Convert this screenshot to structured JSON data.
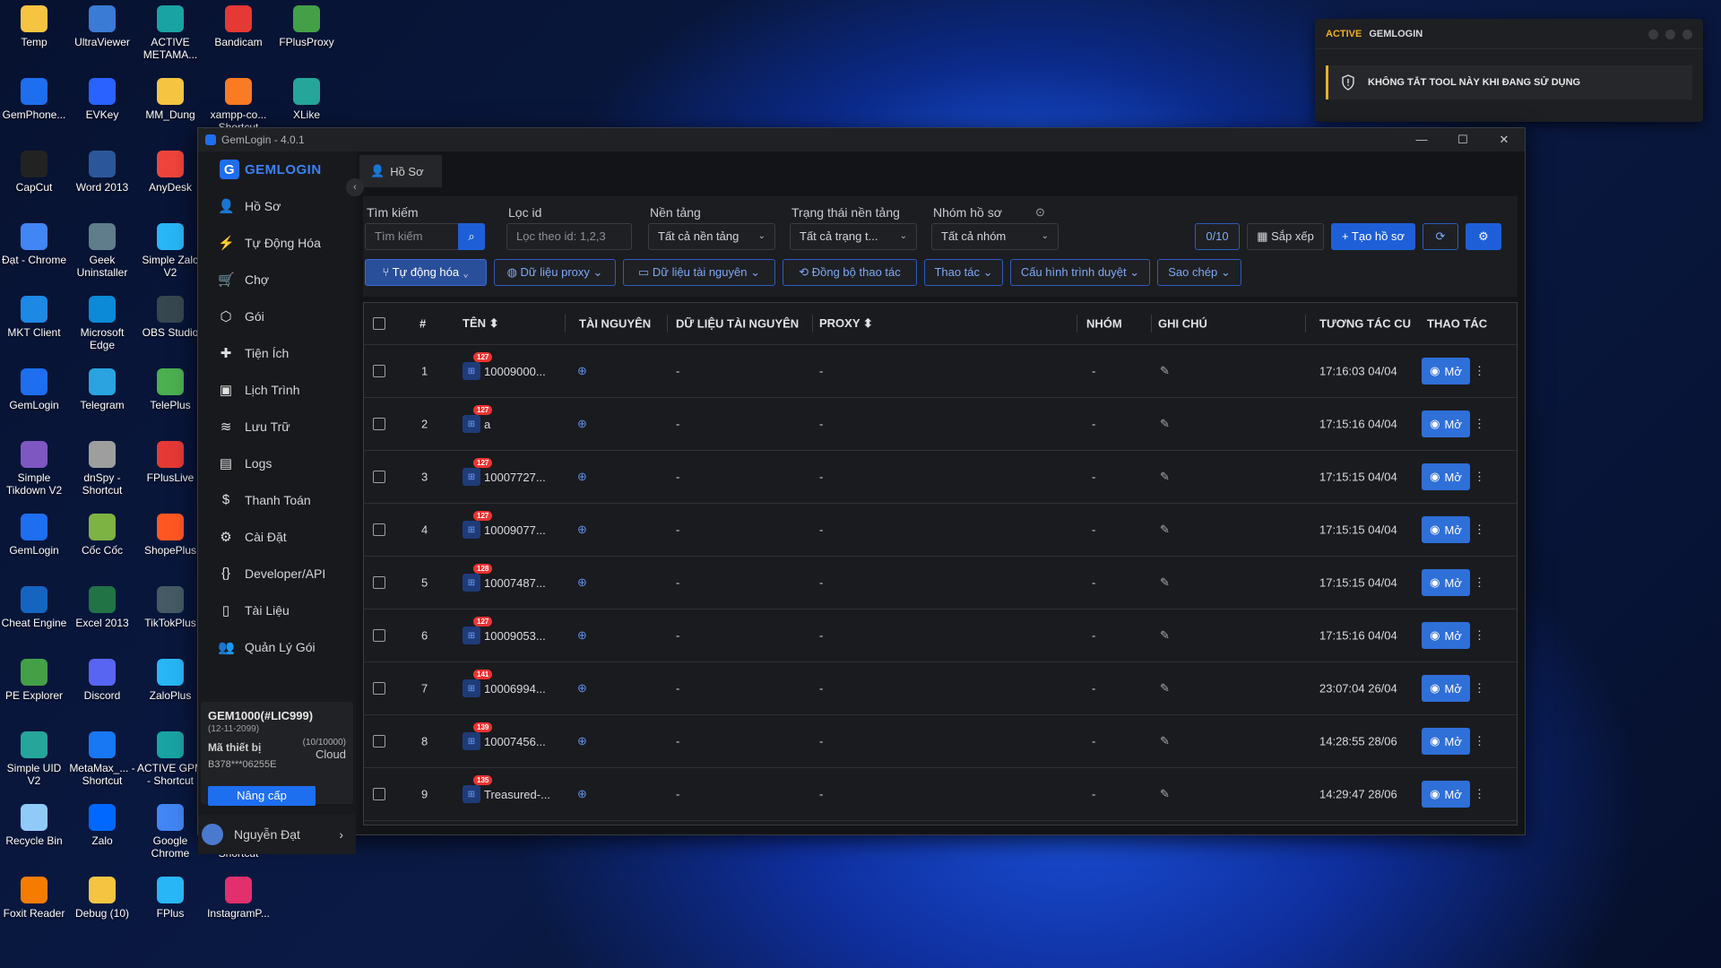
{
  "desktop_icons": [
    {
      "label": "Temp",
      "icon": "folder-icon",
      "color": "#f5c542"
    },
    {
      "label": "UltraViewer",
      "icon": "ultraviewer-icon",
      "color": "#3a7bd5"
    },
    {
      "label": "ACTIVE METAMA...",
      "icon": "edge-icon",
      "color": "#1aa3a3"
    },
    {
      "label": "Bandicam",
      "icon": "record-icon",
      "color": "#e53935"
    },
    {
      "label": "FPlusProxy",
      "icon": "fplusproxy-icon",
      "color": "#43a047"
    },
    {
      "label": "GemPhone...",
      "icon": "gemphone-icon",
      "color": "#1e6ef0"
    },
    {
      "label": "EVKey",
      "icon": "evkey-icon",
      "color": "#2962ff"
    },
    {
      "label": "MM_Dung",
      "icon": "folder-icon",
      "color": "#f5c542"
    },
    {
      "label": "xampp-co... Shortcut",
      "icon": "xampp-icon",
      "color": "#fb7a24"
    },
    {
      "label": "XLike",
      "icon": "xlike-icon",
      "color": "#26a69a"
    },
    {
      "label": "CapCut",
      "icon": "capcut-icon",
      "color": "#222222"
    },
    {
      "label": "Word 2013",
      "icon": "word-icon",
      "color": "#2b579a"
    },
    {
      "label": "AnyDesk",
      "icon": "anydesk-icon",
      "color": "#ef443b"
    },
    {
      "label": "Đạt - Chrome",
      "icon": "chrome-icon",
      "color": "#4285f4"
    },
    {
      "label": "Geek Uninstaller",
      "icon": "geek-icon",
      "color": "#607d8b"
    },
    {
      "label": "Simple Zalo V2",
      "icon": "simplezalo-icon",
      "color": "#29b6f6"
    },
    {
      "label": "MKT Client",
      "icon": "mkt-icon",
      "color": "#1e88e5"
    },
    {
      "label": "Microsoft Edge",
      "icon": "edge-icon",
      "color": "#0c8ad8"
    },
    {
      "label": "OBS Studio",
      "icon": "obs-icon",
      "color": "#37474f"
    },
    {
      "label": "GemLogin",
      "icon": "gemlogin-icon",
      "color": "#1e6ef0"
    },
    {
      "label": "Telegram",
      "icon": "telegram-icon",
      "color": "#2aa3e0"
    },
    {
      "label": "TelePlus",
      "icon": "teleplus-icon",
      "color": "#4caf50"
    },
    {
      "label": "Simple Tikdown V2",
      "icon": "tikdown-icon",
      "color": "#7e57c2"
    },
    {
      "label": "dnSpy - Shortcut",
      "icon": "dnspy-icon",
      "color": "#9e9e9e"
    },
    {
      "label": "FPlusLive",
      "icon": "fpluslive-icon",
      "color": "#e53935"
    },
    {
      "label": "GemLogin",
      "icon": "gemlogin-icon",
      "color": "#1e6ef0"
    },
    {
      "label": "Cốc Cốc",
      "icon": "coccoc-icon",
      "color": "#7cb342"
    },
    {
      "label": "ShopePlus",
      "icon": "shopeplus-icon",
      "color": "#ff5722"
    },
    {
      "label": "Cheat Engine",
      "icon": "cheatengine-icon",
      "color": "#1565c0"
    },
    {
      "label": "Excel 2013",
      "icon": "excel-icon",
      "color": "#217346"
    },
    {
      "label": "TikTokPlus",
      "icon": "tiktokplus-icon",
      "color": "#455a64"
    },
    {
      "label": "PE Explorer",
      "icon": "pe-icon",
      "color": "#43a047"
    },
    {
      "label": "Discord",
      "icon": "discord-icon",
      "color": "#5865f2"
    },
    {
      "label": "ZaloPlus",
      "icon": "zaloplus-icon",
      "color": "#29b6f6"
    },
    {
      "label": "Simple UID V2",
      "icon": "simpleuid-icon",
      "color": "#26a69a"
    },
    {
      "label": "MetaMax_... - Shortcut",
      "icon": "meta-icon",
      "color": "#1877f2"
    },
    {
      "label": "ACTIVE GPM - Shortcut",
      "icon": "edge-icon",
      "color": "#1aa3a3"
    },
    {
      "label": "Recycle Bin",
      "icon": "recycle-icon",
      "color": "#90caf9"
    },
    {
      "label": "Zalo",
      "icon": "zalo-icon",
      "color": "#0068ff"
    },
    {
      "label": "Google Chrome",
      "icon": "chrome-icon",
      "color": "#4285f4"
    },
    {
      "label": "HMax - Shortcut",
      "icon": "hmax-icon",
      "color": "#1e88e5"
    },
    {
      "label": "Foxit Reader",
      "icon": "foxit-icon",
      "color": "#f57c00"
    },
    {
      "label": "Debug (10)",
      "icon": "folder-icon",
      "color": "#f5c542"
    },
    {
      "label": "FPlus",
      "icon": "fplus-icon",
      "color": "#29b6f6"
    },
    {
      "label": "InstagramP...",
      "icon": "instagram-icon",
      "color": "#e1306c"
    }
  ],
  "notification": {
    "active": "ACTIVE",
    "app": "GEMLOGIN",
    "message": "KHÔNG TẮT TOOL NÀY KHI ĐANG SỬ DỤNG"
  },
  "window": {
    "title": "GemLogin - 4.0.1",
    "minimize": "—",
    "maximize": "☐",
    "close": "✕"
  },
  "sidebar": {
    "brand": "GEMLOGIN",
    "items": [
      {
        "label": "Hồ Sơ",
        "icon": "user-icon"
      },
      {
        "label": "Tự Động Hóa",
        "icon": "bolt-icon"
      },
      {
        "label": "Chợ",
        "icon": "cart-icon"
      },
      {
        "label": "Gói",
        "icon": "package-icon"
      },
      {
        "label": "Tiện Ích",
        "icon": "puzzle-icon"
      },
      {
        "label": "Lịch Trình",
        "icon": "calendar-icon"
      },
      {
        "label": "Lưu Trữ",
        "icon": "database-icon"
      },
      {
        "label": "Logs",
        "icon": "file-icon"
      },
      {
        "label": "Thanh Toán",
        "icon": "dollar-icon"
      },
      {
        "label": "Cài Đặt",
        "icon": "gear-icon"
      },
      {
        "label": "Developer/API",
        "icon": "braces-icon"
      },
      {
        "label": "Tài Liệu",
        "icon": "document-icon"
      },
      {
        "label": "Quản Lý Gói",
        "icon": "users-icon"
      }
    ],
    "license": {
      "code": "GEM1000(#LIC999)",
      "expiry": "(12-11-2099)",
      "device_label": "Mã thiết bị",
      "device_id": "B378***06255E",
      "quota": "(10/10000)",
      "storage": "Cloud",
      "upgrade": "Nâng cấp"
    },
    "user": "Nguyễn Đạt"
  },
  "tab": {
    "label": "Hồ Sơ"
  },
  "filters": {
    "search_label": "Tìm kiếm",
    "search_placeholder": "Tìm kiếm",
    "id_label": "Lọc id",
    "id_placeholder": "Lọc theo id: 1,2,3",
    "platform_label": "Nền tảng",
    "platform_value": "Tất cả nền tảng",
    "status_label": "Trạng thái nền tảng",
    "status_value": "Tất cả trạng t...",
    "group_label": "Nhóm hồ sơ",
    "group_value": "Tất cả nhóm",
    "count": "0/10",
    "sort": "Sắp xếp",
    "create": "Tạo hồ sơ"
  },
  "toolbar": {
    "automation": "Tự động hóa",
    "proxy_data": "Dữ liệu proxy",
    "resource_data": "Dữ liệu tài nguyên",
    "sync": "Đồng bộ thao tác",
    "actions": "Thao tác",
    "browser_config": "Cấu hình trình duyệt",
    "copy": "Sao chép"
  },
  "table": {
    "headers": {
      "num": "#",
      "name": "TÊN",
      "resource": "TÀI NGUYÊN",
      "resource_data": "DỮ LIỆU TÀI NGUYÊN",
      "proxy": "PROXY",
      "group": "NHÓM",
      "note": "GHI CHÚ",
      "last": "TƯƠNG TÁC CU",
      "action": "THAO TÁC"
    },
    "open_label": "Mở",
    "rows": [
      {
        "num": "1",
        "badge": "127",
        "name": "10009000...",
        "resource_data": "-",
        "proxy": "-",
        "group": "-",
        "time": "17:16:03 04/04"
      },
      {
        "num": "2",
        "badge": "127",
        "name": "a",
        "resource_data": "-",
        "proxy": "-",
        "group": "-",
        "time": "17:15:16 04/04"
      },
      {
        "num": "3",
        "badge": "127",
        "name": "10007727...",
        "resource_data": "-",
        "proxy": "-",
        "group": "-",
        "time": "17:15:15 04/04"
      },
      {
        "num": "4",
        "badge": "127",
        "name": "10009077...",
        "resource_data": "-",
        "proxy": "-",
        "group": "-",
        "time": "17:15:15 04/04"
      },
      {
        "num": "5",
        "badge": "128",
        "name": "10007487...",
        "resource_data": "-",
        "proxy": "-",
        "group": "-",
        "time": "17:15:15 04/04"
      },
      {
        "num": "6",
        "badge": "127",
        "name": "10009053...",
        "resource_data": "-",
        "proxy": "-",
        "group": "-",
        "time": "17:15:16 04/04"
      },
      {
        "num": "7",
        "badge": "141",
        "name": "10006994...",
        "resource_data": "-",
        "proxy": "-",
        "group": "-",
        "time": "23:07:04 26/04"
      },
      {
        "num": "8",
        "badge": "139",
        "name": "10007456...",
        "resource_data": "-",
        "proxy": "-",
        "group": "-",
        "time": "14:28:55 28/06"
      },
      {
        "num": "9",
        "badge": "135",
        "name": "Treasured-...",
        "resource_data": "-",
        "proxy": "-",
        "group": "-",
        "time": "14:29:47 28/06"
      }
    ]
  }
}
